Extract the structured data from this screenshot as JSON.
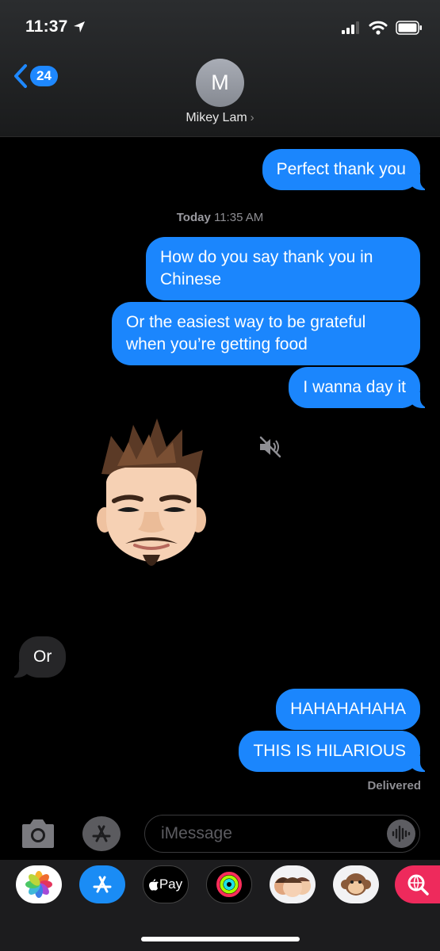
{
  "status_bar": {
    "time": "11:37"
  },
  "nav": {
    "back_count": "24",
    "avatar_initial": "M",
    "contact_name": "Mikey Lam",
    "chevron": "›"
  },
  "messages": [
    {
      "text": "Perfect thank you",
      "direction": "outgoing"
    },
    {
      "text": "How do you say thank you in Chinese",
      "direction": "outgoing"
    },
    {
      "text": "Or the easiest way to be grateful when you’re getting food",
      "direction": "outgoing"
    },
    {
      "text": "I wanna day it",
      "direction": "outgoing"
    },
    {
      "text": "Or",
      "direction": "incoming"
    },
    {
      "text": "HAHAHAHAHA",
      "direction": "outgoing"
    },
    {
      "text": "THIS IS HILARIOUS",
      "direction": "outgoing"
    }
  ],
  "timestamp": {
    "day": "Today",
    "time": "11:35 AM"
  },
  "delivered_label": "Delivered",
  "memoji": {
    "icon": "memoji-sticker",
    "muted_icon": "speaker-muted-icon"
  },
  "input": {
    "placeholder": "iMessage"
  },
  "app_drawer": [
    {
      "name": "photos-app-icon"
    },
    {
      "name": "app-store-icon"
    },
    {
      "name": "apple-pay-icon",
      "label": "Pay"
    },
    {
      "name": "activity-icon"
    },
    {
      "name": "memoji-app-icon"
    },
    {
      "name": "animoji-app-icon"
    },
    {
      "name": "search-images-icon"
    }
  ],
  "colors": {
    "outgoing_bubble": "#1b86fd",
    "incoming_bubble": "#262628",
    "background": "#000000",
    "accent": "#1e88ff"
  }
}
